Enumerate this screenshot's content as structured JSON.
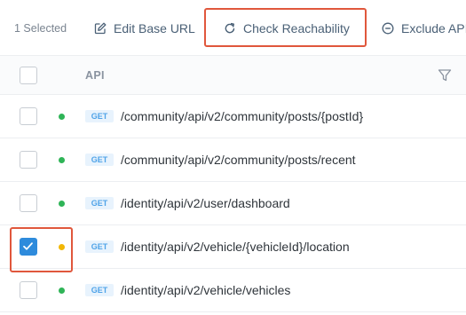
{
  "toolbar": {
    "selected_count": "1 Selected",
    "edit_base_url_label": "Edit Base URL",
    "check_reachability_label": "Check Reachability",
    "exclude_api_label": "Exclude API"
  },
  "table": {
    "column_header": "API",
    "rows": [
      {
        "checked": false,
        "status": "green",
        "method": "GET",
        "path": "/community/api/v2/community/posts/{postId}"
      },
      {
        "checked": false,
        "status": "green",
        "method": "GET",
        "path": "/community/api/v2/community/posts/recent"
      },
      {
        "checked": false,
        "status": "green",
        "method": "GET",
        "path": "/identity/api/v2/user/dashboard"
      },
      {
        "checked": true,
        "status": "yellow",
        "method": "GET",
        "path": "/identity/api/v2/vehicle/{vehicleId}/location"
      },
      {
        "checked": false,
        "status": "green",
        "method": "GET",
        "path": "/identity/api/v2/vehicle/vehicles"
      }
    ]
  },
  "colors": {
    "accent": "#2e8bdc",
    "highlight": "#e0573c",
    "status_green": "#2fb457",
    "status_yellow": "#f2b705"
  },
  "icons": {
    "edit": "edit-icon",
    "refresh": "refresh-icon",
    "exclude": "minus-circle-icon",
    "filter": "filter-icon"
  }
}
